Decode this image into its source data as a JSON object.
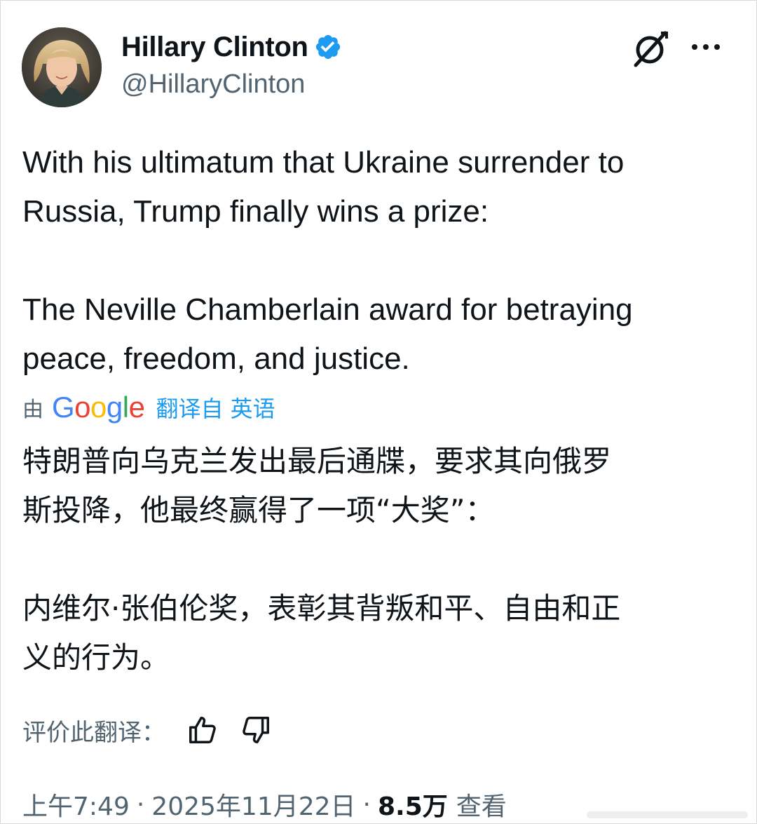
{
  "author": {
    "display_name": "Hillary Clinton",
    "handle": "@HillaryClinton",
    "verified_icon": "verified-badge-icon"
  },
  "header_actions": {
    "grok_icon": "grok-icon",
    "more_icon": "more-options-icon"
  },
  "tweet": {
    "text": "With his ultimatum that Ukraine surrender to\nRussia, Trump finally wins a prize:\n\nThe Neville Chamberlain award for betraying\npeace, freedom, and justice."
  },
  "translation": {
    "by_prefix": "由",
    "provider_letters": [
      "G",
      "o",
      "o",
      "g",
      "l",
      "e"
    ],
    "provider_colors": [
      "#4285F4",
      "#EA4335",
      "#FBBC05",
      "#4285F4",
      "#34A853",
      "#EA4335"
    ],
    "link_label": "翻译自 英语",
    "text": "特朗普向乌克兰发出最后通牒，要求其向俄罗\n斯投降，他最终赢得了一项“大奖”：\n\n内维尔·张伯伦奖，表彰其背叛和平、自由和正\n义的行为。",
    "rate_label": "评价此翻译：",
    "thumbs_up_icon": "thumbs-up-icon",
    "thumbs_down_icon": "thumbs-down-icon"
  },
  "meta": {
    "time": "上午7:49",
    "separator": "·",
    "date": "2025年11月22日",
    "views_count": "8.5万",
    "views_label": "查看"
  },
  "colors": {
    "link_blue": "#1d9bf0",
    "secondary_text": "#536471",
    "primary_text": "#0f1419"
  }
}
